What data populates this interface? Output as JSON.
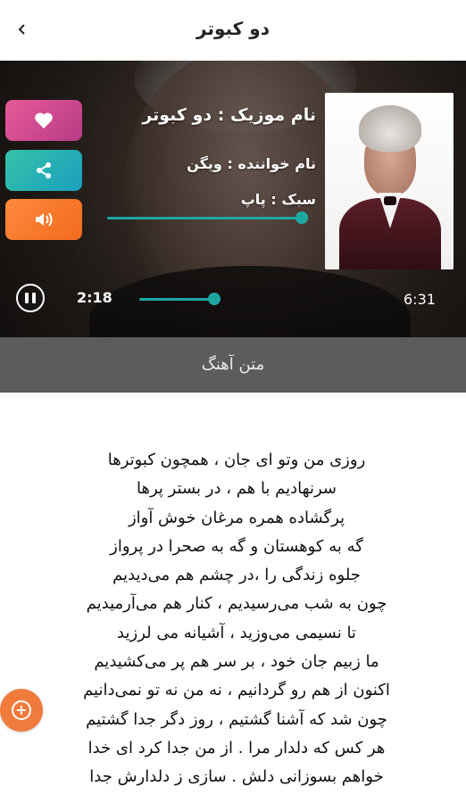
{
  "header": {
    "title": "دو کبوتر",
    "back_icon": "chevron-left-icon"
  },
  "player": {
    "song_name": "نام موزیک : دو کبوتر",
    "singer": "نام خواننده : ویگن",
    "genre": "سبک : پاپ",
    "current_time": "2:18",
    "total_time": "6:31",
    "progress_fraction": 0.35,
    "volume_fraction": 0.97,
    "actions": [
      {
        "icon": "heart-icon",
        "color": "#d94a92"
      },
      {
        "icon": "share-icon",
        "color": "#27b3b3"
      },
      {
        "icon": "volume-icon",
        "color": "#f57a2c"
      }
    ],
    "accent_color": "#1ea7a1"
  },
  "lyrics_tab": {
    "label": "متن آهنگ"
  },
  "lyrics": {
    "lines": [
      "روزی من وتو ای جان ، همچون کبوترها",
      "سرنهادیم با هم ، در بستر پرها",
      "پرگشاده همره مرغان خوش آواز",
      "گه به کوهستان و گه به صحرا در پرواز",
      "جلوه زندگی را ،در چشم هم می‌دیدیم",
      "چون به شب می‌رسیدیم ، کنار هم می‌آرمیدیم",
      "تا نسیمی می‌وزید ، آشیانه می لرزید",
      "ما زبیم جان خود ، بر سر هم پر می‌کشیدیم",
      "اکنون از هم رو گردانیم ، نه من نه تو نمی‌دانیم",
      "چون شد که آشنا گشتیم ، روز دگر جدا گشتیم",
      "هر کس که دلدار مرا . از من جدا کرد ای خدا",
      "خواهم بسوزانی دلش . سازی ز دلدارش جدا"
    ]
  },
  "fab": {
    "icon": "add-circle-icon",
    "color": "#f07b3c"
  }
}
